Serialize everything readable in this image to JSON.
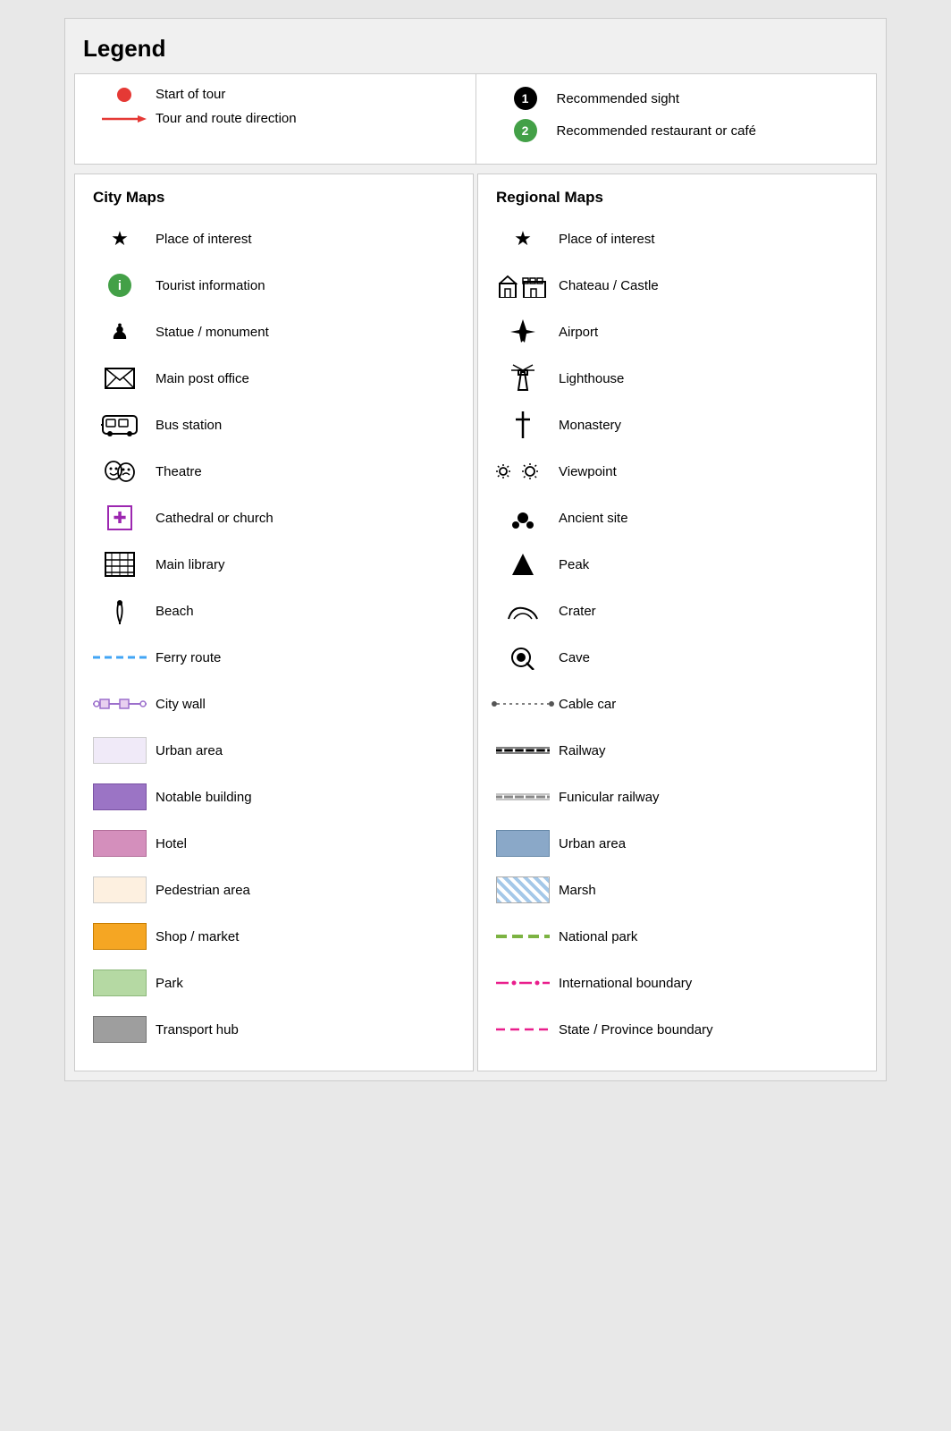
{
  "legend": {
    "title": "Legend",
    "top": {
      "left": [
        {
          "icon": "red-dot",
          "label": "Start of tour"
        },
        {
          "icon": "arrow",
          "label": "Tour and route direction"
        }
      ],
      "right": [
        {
          "icon": "black-circle-1",
          "label": "Recommended sight"
        },
        {
          "icon": "green-circle-2",
          "label": "Recommended restaurant or café"
        }
      ]
    },
    "city_maps": {
      "header": "City Maps",
      "items": [
        {
          "icon": "star",
          "label": "Place of interest"
        },
        {
          "icon": "green-info",
          "label": "Tourist information"
        },
        {
          "icon": "statue",
          "label": "Statue / monument"
        },
        {
          "icon": "post-office",
          "label": "Main post office"
        },
        {
          "icon": "bus",
          "label": "Bus station"
        },
        {
          "icon": "theatre",
          "label": "Theatre"
        },
        {
          "icon": "cathedral",
          "label": "Cathedral or church"
        },
        {
          "icon": "library",
          "label": "Main library"
        },
        {
          "icon": "beach",
          "label": "Beach"
        },
        {
          "icon": "ferry",
          "label": "Ferry route"
        },
        {
          "icon": "city-wall",
          "label": "City wall"
        },
        {
          "icon": "urban-box",
          "label": "Urban area",
          "color": "#f0eaf8"
        },
        {
          "icon": "notable-box",
          "label": "Notable building",
          "color": "#9b74c5"
        },
        {
          "icon": "hotel-box",
          "label": "Hotel",
          "color": "#d48fbc"
        },
        {
          "icon": "pedestrian-box",
          "label": "Pedestrian area",
          "color": "#fdf0e0"
        },
        {
          "icon": "shop-box",
          "label": "Shop / market",
          "color": "#f5a623"
        },
        {
          "icon": "park-box",
          "label": "Park",
          "color": "#b5d9a3"
        },
        {
          "icon": "transport-box",
          "label": "Transport hub",
          "color": "#9e9e9e"
        }
      ]
    },
    "regional_maps": {
      "header": "Regional Maps",
      "items": [
        {
          "icon": "star",
          "label": "Place of interest"
        },
        {
          "icon": "chateau",
          "label": "Chateau / Castle"
        },
        {
          "icon": "airport",
          "label": "Airport"
        },
        {
          "icon": "lighthouse",
          "label": "Lighthouse"
        },
        {
          "icon": "monastery",
          "label": "Monastery"
        },
        {
          "icon": "viewpoint",
          "label": "Viewpoint"
        },
        {
          "icon": "ancient",
          "label": "Ancient site"
        },
        {
          "icon": "peak",
          "label": "Peak"
        },
        {
          "icon": "crater",
          "label": "Crater"
        },
        {
          "icon": "cave",
          "label": "Cave"
        },
        {
          "icon": "cable-car",
          "label": "Cable car"
        },
        {
          "icon": "railway",
          "label": "Railway"
        },
        {
          "icon": "funicular",
          "label": "Funicular railway"
        },
        {
          "icon": "urban-blue-box",
          "label": "Urban area",
          "color": "#8aa8c8"
        },
        {
          "icon": "marsh",
          "label": "Marsh"
        },
        {
          "icon": "national-park",
          "label": "National park"
        },
        {
          "icon": "intl-boundary",
          "label": "International boundary"
        },
        {
          "icon": "state-boundary",
          "label": "State / Province boundary"
        }
      ]
    }
  }
}
